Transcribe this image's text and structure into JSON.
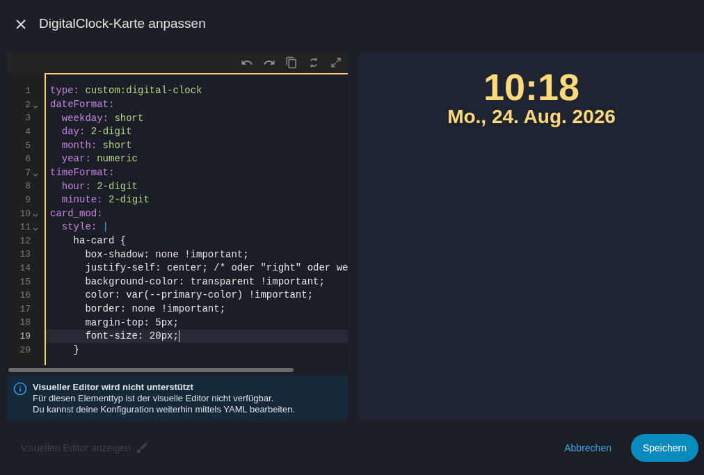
{
  "dialog": {
    "title": "DigitalClock-Karte anpassen"
  },
  "editor": {
    "lines": [
      {
        "number": "1",
        "foldable": false,
        "current": false,
        "segments": [
          {
            "kind": "key",
            "text": "type:"
          },
          {
            "kind": "value",
            "text": " custom:digital-clock"
          }
        ]
      },
      {
        "number": "2",
        "foldable": true,
        "current": false,
        "segments": [
          {
            "kind": "key",
            "text": "dateFormat:"
          }
        ]
      },
      {
        "number": "3",
        "foldable": false,
        "current": false,
        "segments": [
          {
            "kind": "key",
            "text": "  weekday:"
          },
          {
            "kind": "value",
            "text": " short"
          }
        ]
      },
      {
        "number": "4",
        "foldable": false,
        "current": false,
        "segments": [
          {
            "kind": "key",
            "text": "  day:"
          },
          {
            "kind": "value",
            "text": " 2-digit"
          }
        ]
      },
      {
        "number": "5",
        "foldable": false,
        "current": false,
        "segments": [
          {
            "kind": "key",
            "text": "  month:"
          },
          {
            "kind": "value",
            "text": " short"
          }
        ]
      },
      {
        "number": "6",
        "foldable": false,
        "current": false,
        "segments": [
          {
            "kind": "key",
            "text": "  year:"
          },
          {
            "kind": "value",
            "text": " numeric"
          }
        ]
      },
      {
        "number": "7",
        "foldable": true,
        "current": false,
        "segments": [
          {
            "kind": "key",
            "text": "timeFormat:"
          }
        ]
      },
      {
        "number": "8",
        "foldable": false,
        "current": false,
        "segments": [
          {
            "kind": "key",
            "text": "  hour:"
          },
          {
            "kind": "value",
            "text": " 2-digit"
          }
        ]
      },
      {
        "number": "9",
        "foldable": false,
        "current": false,
        "segments": [
          {
            "kind": "key",
            "text": "  minute:"
          },
          {
            "kind": "value",
            "text": " 2-digit"
          }
        ]
      },
      {
        "number": "10",
        "foldable": true,
        "current": false,
        "segments": [
          {
            "kind": "key",
            "text": "card_mod:"
          }
        ]
      },
      {
        "number": "11",
        "foldable": true,
        "current": false,
        "segments": [
          {
            "kind": "key",
            "text": "  style:"
          },
          {
            "kind": "pipe",
            "text": " |"
          }
        ]
      },
      {
        "number": "12",
        "foldable": false,
        "current": false,
        "segments": [
          {
            "kind": "plain",
            "text": "    ha-card {"
          }
        ]
      },
      {
        "number": "13",
        "foldable": false,
        "current": false,
        "segments": [
          {
            "kind": "plain",
            "text": "      box-shadow: none !important;"
          }
        ]
      },
      {
        "number": "14",
        "foldable": false,
        "current": false,
        "segments": [
          {
            "kind": "plain",
            "text": "      justify-self: center; /* oder \"right\" oder we"
          }
        ]
      },
      {
        "number": "15",
        "foldable": false,
        "current": false,
        "segments": [
          {
            "kind": "plain",
            "text": "      background-color: transparent !important;"
          }
        ]
      },
      {
        "number": "16",
        "foldable": false,
        "current": false,
        "segments": [
          {
            "kind": "plain",
            "text": "      color: var(--primary-color) !important;"
          }
        ]
      },
      {
        "number": "17",
        "foldable": false,
        "current": false,
        "segments": [
          {
            "kind": "plain",
            "text": "      border: none !important;"
          }
        ]
      },
      {
        "number": "18",
        "foldable": false,
        "current": false,
        "segments": [
          {
            "kind": "plain",
            "text": "      margin-top: 5px;"
          }
        ]
      },
      {
        "number": "19",
        "foldable": false,
        "current": true,
        "segments": [
          {
            "kind": "plain",
            "text": "      font-size: 20px;"
          }
        ]
      },
      {
        "number": "20",
        "foldable": false,
        "current": false,
        "segments": [
          {
            "kind": "plain",
            "text": "    }"
          }
        ]
      }
    ]
  },
  "alert": {
    "title": "Visueller Editor wird nicht unterstützt",
    "lines": [
      "Für diesen Elementtyp ist der visuelle Editor nicht verfügbar.",
      "Du kannst deine Konfiguration weiterhin mittels YAML bearbeiten."
    ]
  },
  "preview": {
    "time": "10:18",
    "date": "Mo., 24. Aug. 2026"
  },
  "footer": {
    "toggle": {
      "label": "Visuellen Editor anzeigen",
      "disabled": true
    },
    "cancel": "Abbrechen",
    "save": "Speichern"
  }
}
